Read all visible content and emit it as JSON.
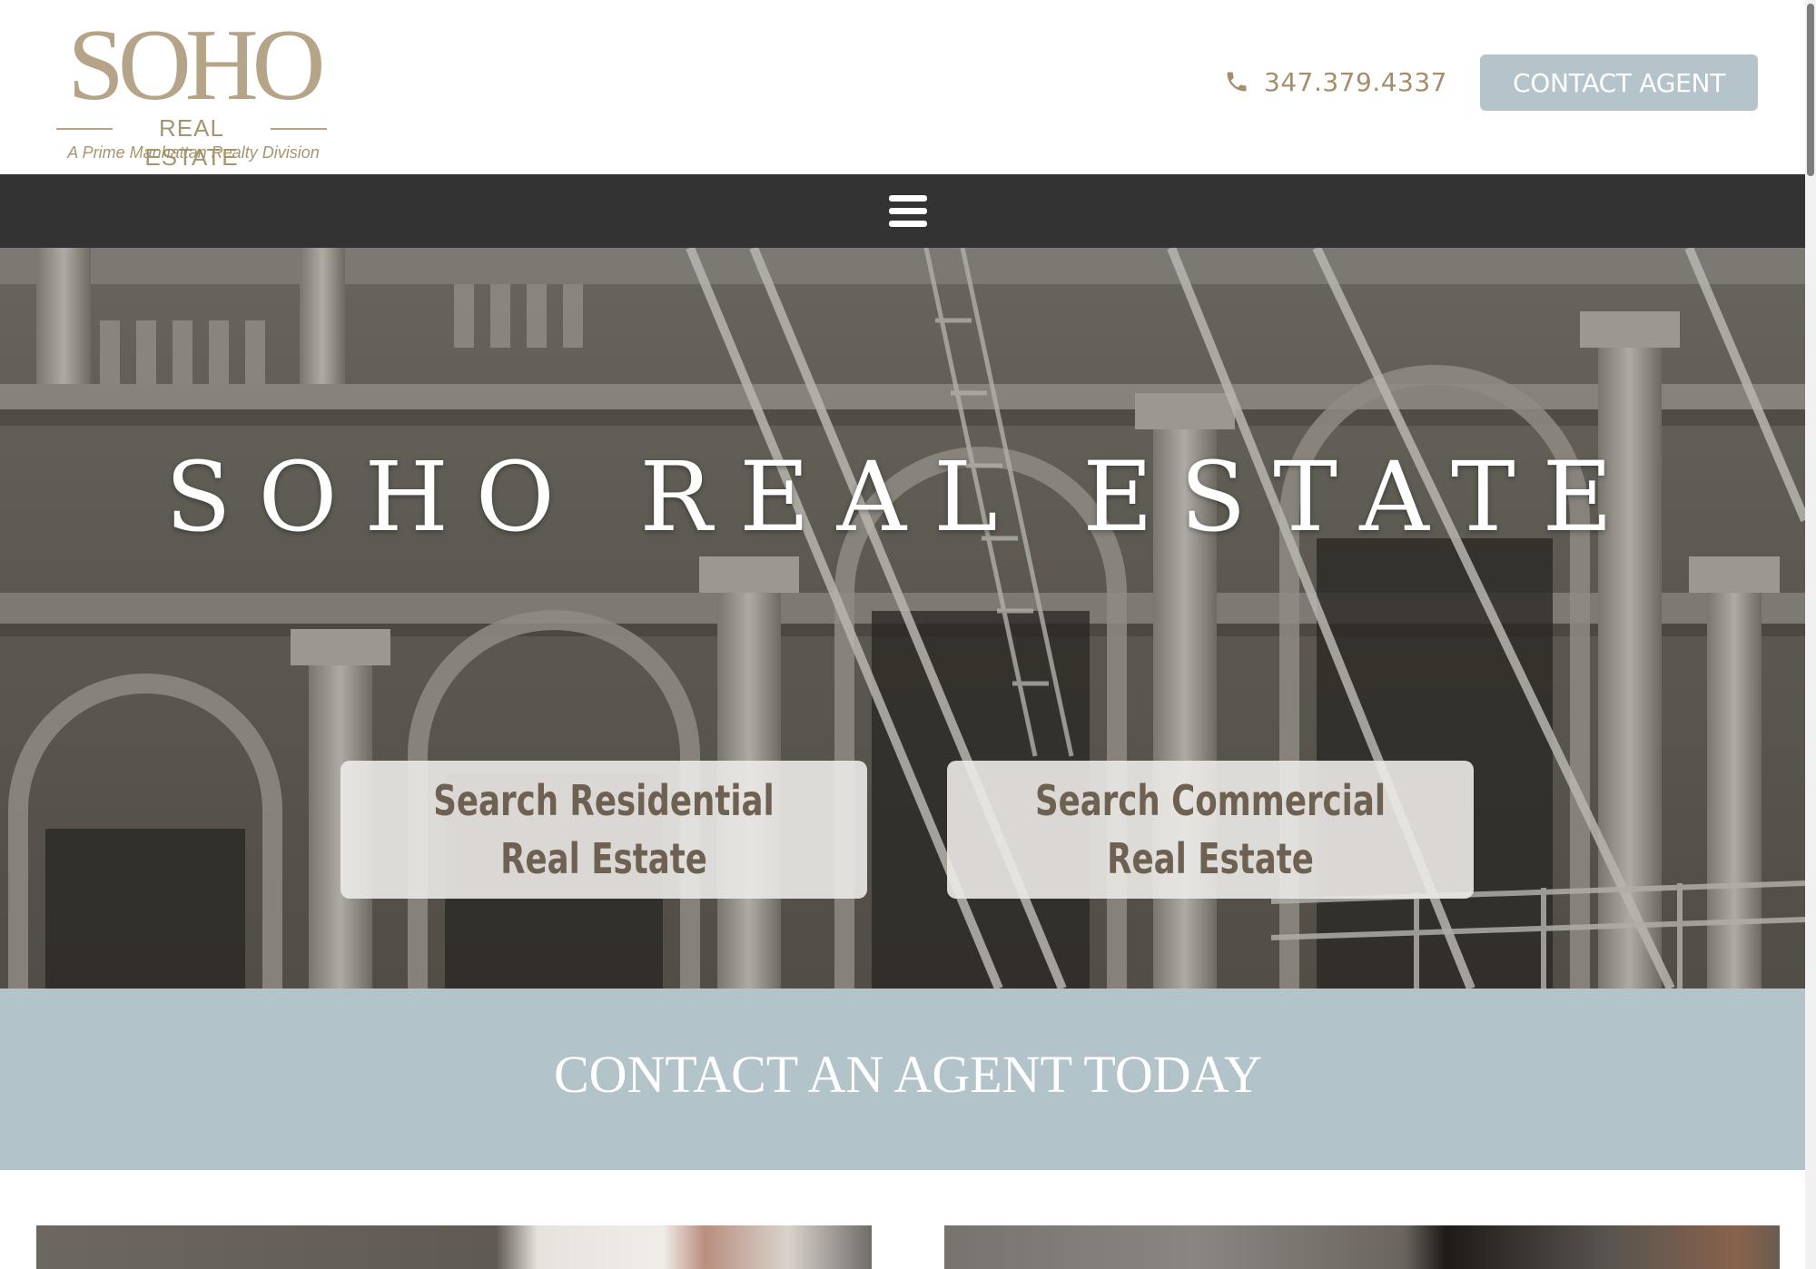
{
  "header": {
    "logo": {
      "main": "SOHO",
      "sub": "REAL ESTATE",
      "tagline": "A Prime Manhattan Realty Division"
    },
    "phone": "347.379.4337",
    "phone_icon": "phone-icon",
    "contact_button": "CONTACT AGENT"
  },
  "nav": {
    "menu_icon": "hamburger-menu-icon"
  },
  "hero": {
    "title": "SOHO REAL ESTATE",
    "buttons": [
      {
        "line1": "Search Residential",
        "line2": "Real Estate"
      },
      {
        "line1": "Search Commercial",
        "line2": "Real Estate"
      }
    ]
  },
  "contact_band": {
    "text": "CONTACT AN AGENT TODAY"
  },
  "colors": {
    "brand_gold": "#b5a487",
    "accent_blue_gray": "#b3c3ca",
    "nav_dark": "#333333",
    "button_text": "#6e6152"
  }
}
